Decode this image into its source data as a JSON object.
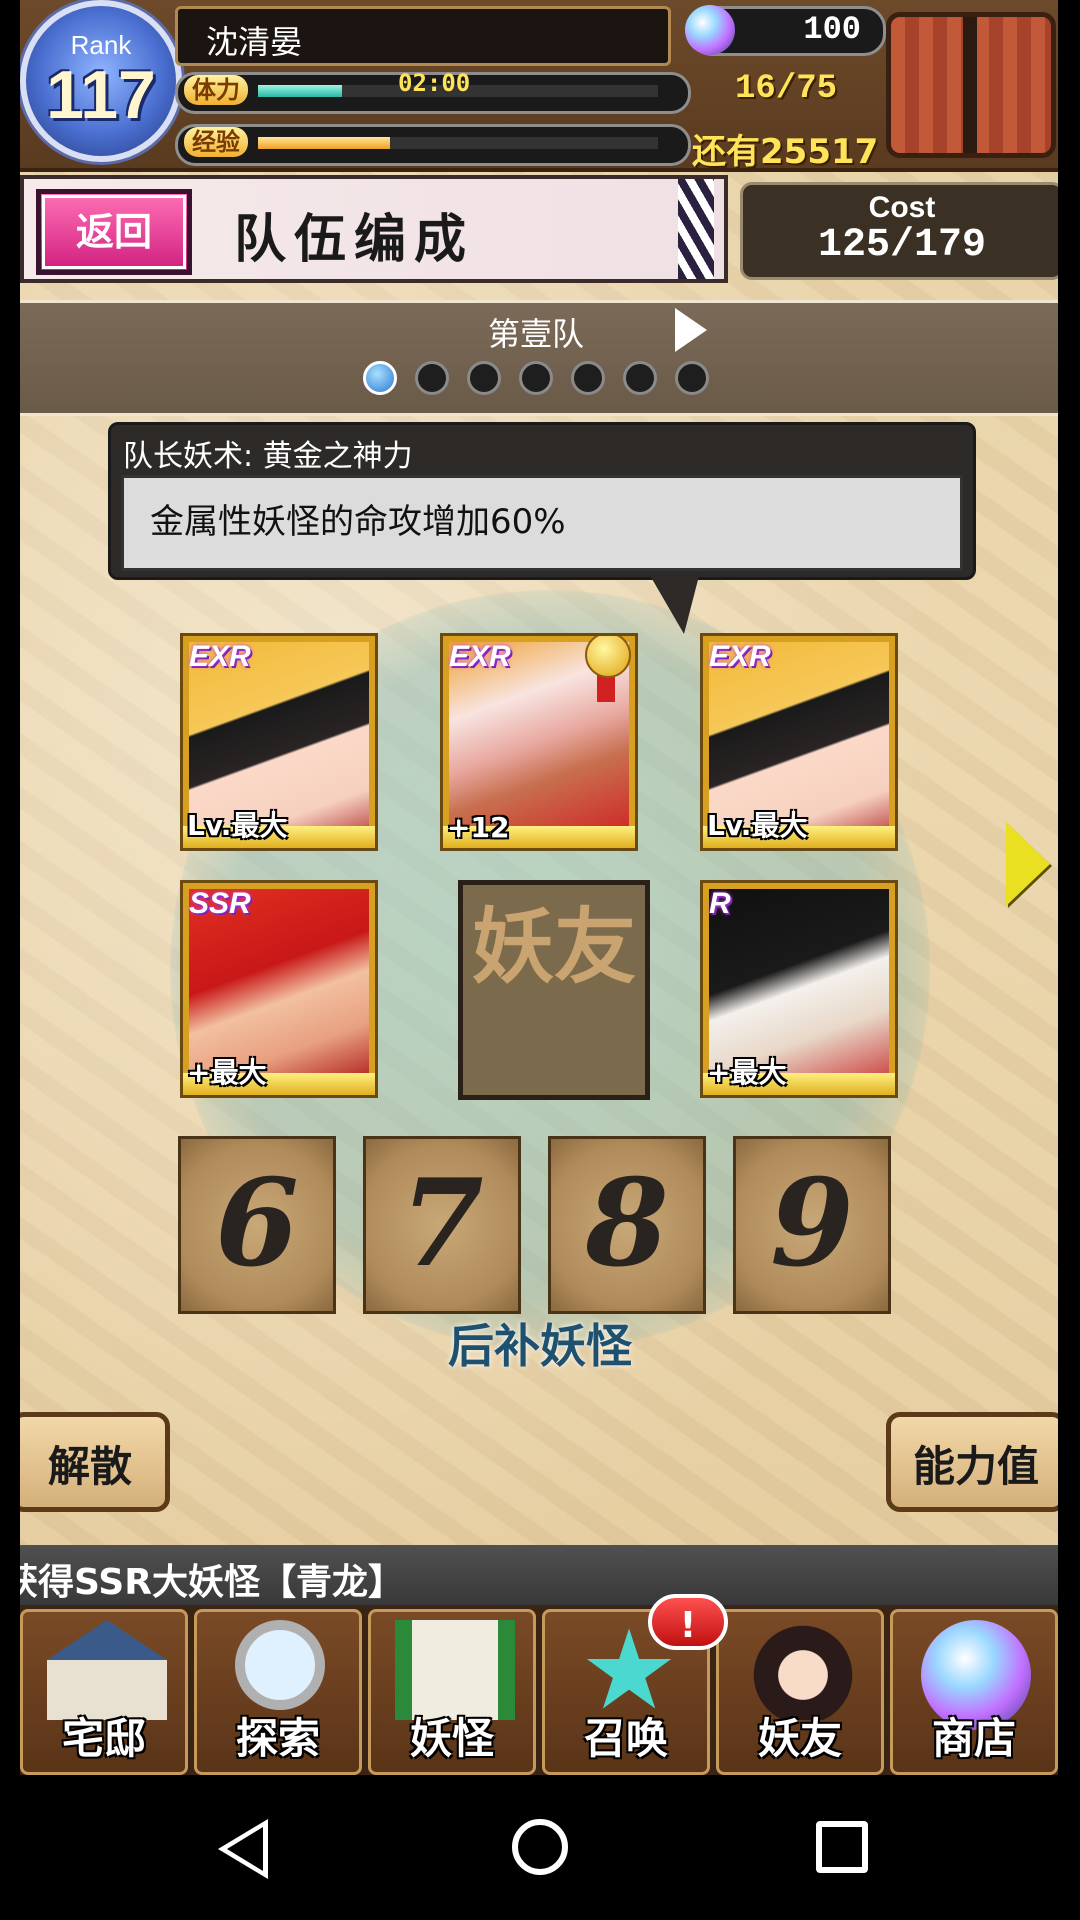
{
  "header": {
    "rank_label": "Rank",
    "rank_value": "117",
    "player_name": "沈清晏",
    "stamina_label": "体力",
    "stamina_timer": "02:00",
    "stamina_count": "16/75",
    "stamina_fraction": 0.21,
    "exp_label": "经验",
    "exp_remaining": "还有25517",
    "exp_fraction": 0.33,
    "gem_count": "100",
    "gem_icon": "crystal-orb-icon",
    "chest_icon": "gift-chest-icon"
  },
  "title_bar": {
    "back_label": "返回",
    "title": "队伍编成",
    "cost_label": "Cost",
    "cost_value": "125/179"
  },
  "team": {
    "name": "第壹队",
    "page_count": 7,
    "active_page": 1
  },
  "leader_skill": {
    "title": "队长妖术: 黄金之神力",
    "description": "金属性妖怪的命攻增加60%"
  },
  "members": [
    {
      "rarity": "EXR",
      "level": "Lv.最大"
    },
    {
      "rarity": "EXR",
      "level": "+12",
      "leader": true
    },
    {
      "rarity": "EXR",
      "level": "Lv.最大"
    },
    {
      "rarity": "SSR",
      "level": "+最大"
    },
    {
      "rarity": "",
      "level": "妖友",
      "friend_slot": true
    },
    {
      "rarity": "R",
      "level": "+最大"
    }
  ],
  "reserve": {
    "slots": [
      "6",
      "7",
      "8",
      "9"
    ],
    "label": "后补妖怪"
  },
  "buttons": {
    "disband": "解散",
    "stats": "能力值"
  },
  "ticker": "获得SSR大妖怪【青龙】",
  "nav": [
    {
      "label": "宅邸",
      "icon": "house-icon"
    },
    {
      "label": "探索",
      "icon": "magnifier-icon"
    },
    {
      "label": "妖怪",
      "icon": "scroll-icon"
    },
    {
      "label": "召唤",
      "icon": "pentagram-icon"
    },
    {
      "label": "妖友",
      "icon": "catgirl-icon"
    },
    {
      "label": "商店",
      "icon": "orb-icon"
    }
  ],
  "summon_badge": "!",
  "colors": {
    "accent_pink": "#d02080",
    "stamina": "#28b8a3",
    "exp": "#f0a020",
    "highlight_yellow": "#ffe45a"
  }
}
